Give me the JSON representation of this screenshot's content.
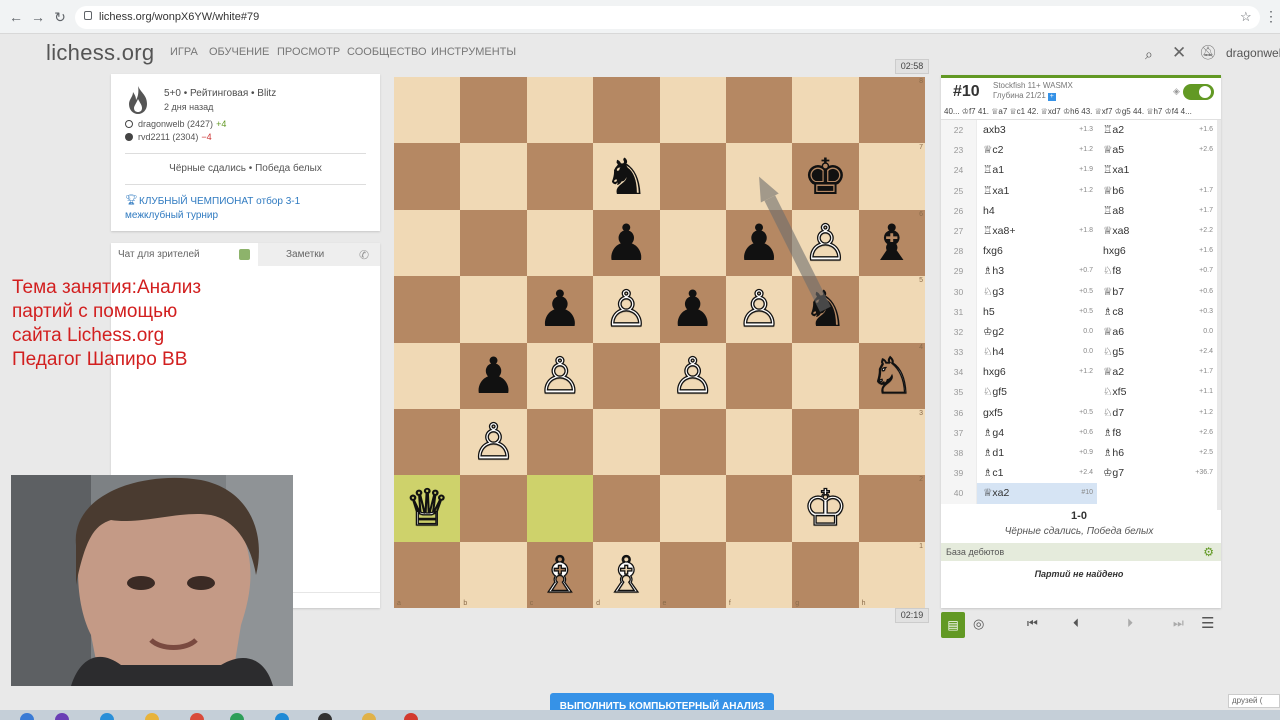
{
  "browser": {
    "url": "lichess.org/wonpX6YW/white#79",
    "back_icon": "back-arrow-icon",
    "forward_icon": "forward-arrow-icon",
    "reload_icon": "reload-icon"
  },
  "header": {
    "logo": "lichess.org",
    "nav": [
      "ИГРА",
      "ОБУЧЕНИЕ",
      "ПРОСМОТР",
      "СООБЩЕСТВО",
      "ИНСТРУМЕНТЫ"
    ],
    "username": "dragonwelb"
  },
  "game": {
    "meta": "5+0 • Рейтинговая • Blitz",
    "ago": "2 дня назад",
    "white": {
      "name": "dragonwelb (2427)",
      "diff": "+4"
    },
    "black": {
      "name": "rvd2211 (2304)",
      "diff": "−4"
    },
    "result": "Чёрные сдались • Победа белых",
    "tournament": "КЛУБНЫЙ ЧЕМПИОНАТ отбор 3-1 межклубный турнир"
  },
  "chat": {
    "tab": "Чат для зрителей",
    "notes": "Заметки"
  },
  "lesson_overlay": "Тема занятия:Анализ\nпартий с помощью\nсайта Lichess.org\nПедагог Шапиро ВВ",
  "clocks": {
    "top": "02:58",
    "bottom": "02:19"
  },
  "board": {
    "pieces": [
      {
        "sq": "d7",
        "p": "♞",
        "c": "b"
      },
      {
        "sq": "g7",
        "p": "♚",
        "c": "b"
      },
      {
        "sq": "d6",
        "p": "♟",
        "c": "b"
      },
      {
        "sq": "f6",
        "p": "♟",
        "c": "b"
      },
      {
        "sq": "g6",
        "p": "♙",
        "c": "w"
      },
      {
        "sq": "h6",
        "p": "♝",
        "c": "b"
      },
      {
        "sq": "c5",
        "p": "♟",
        "c": "b"
      },
      {
        "sq": "d5",
        "p": "♙",
        "c": "w"
      },
      {
        "sq": "e5",
        "p": "♟",
        "c": "b"
      },
      {
        "sq": "f5",
        "p": "♙",
        "c": "w"
      },
      {
        "sq": "g5",
        "p": "♞",
        "c": "b"
      },
      {
        "sq": "b4",
        "p": "♟",
        "c": "b"
      },
      {
        "sq": "c4",
        "p": "♙",
        "c": "w"
      },
      {
        "sq": "e4",
        "p": "♙",
        "c": "w"
      },
      {
        "sq": "h4",
        "p": "♘",
        "c": "w"
      },
      {
        "sq": "b3",
        "p": "♙",
        "c": "w"
      },
      {
        "sq": "a2",
        "p": "♕",
        "c": "w"
      },
      {
        "sq": "g2",
        "p": "♔",
        "c": "w"
      },
      {
        "sq": "c1",
        "p": "♗",
        "c": "w"
      },
      {
        "sq": "d1",
        "p": "♗",
        "c": "w"
      }
    ],
    "highlights": [
      "a2",
      "c2"
    ],
    "files": [
      "a",
      "b",
      "c",
      "d",
      "e",
      "f",
      "g",
      "h"
    ],
    "ranks": [
      "8",
      "7",
      "6",
      "5",
      "4",
      "3",
      "2",
      "1"
    ],
    "arrow": {
      "from": "g5",
      "to": "f7"
    }
  },
  "engine": {
    "eval": "#10",
    "name": "Stockfish 11+ WASMX",
    "depth": "Глубина 21/21",
    "pv": "40... ♔f7 41. ♕a7 ♕c1 42. ♕xd7 ♔h6 43. ♕xf7 ♔g5 44. ♕h7 ♔f4 4..."
  },
  "moves": [
    {
      "n": "22",
      "w": "axb3",
      "we": "+1.3",
      "b": "♖a2",
      "be": "+1.6"
    },
    {
      "n": "23",
      "w": "♕c2",
      "we": "+1.2",
      "b": "♕a5",
      "be": "+2.6"
    },
    {
      "n": "24",
      "w": "♖a1",
      "we": "+1.9",
      "b": "♖xa1",
      "be": ""
    },
    {
      "n": "25",
      "w": "♖xa1",
      "we": "+1.2",
      "b": "♕b6",
      "be": "+1.7"
    },
    {
      "n": "26",
      "w": "h4",
      "we": "",
      "b": "♖a8",
      "be": "+1.7"
    },
    {
      "n": "27",
      "w": "♖xa8+",
      "we": "+1.8",
      "b": "♕xa8",
      "be": "+2.2"
    },
    {
      "n": "28",
      "w": "fxg6",
      "we": "",
      "b": "hxg6",
      "be": "+1.6"
    },
    {
      "n": "29",
      "w": "♗h3",
      "we": "+0.7",
      "b": "♘f8",
      "be": "+0.7"
    },
    {
      "n": "30",
      "w": "♘g3",
      "we": "+0.5",
      "b": "♕b7",
      "be": "+0.6"
    },
    {
      "n": "31",
      "w": "h5",
      "we": "+0.5",
      "b": "♗c8",
      "be": "+0.3"
    },
    {
      "n": "32",
      "w": "♔g2",
      "we": "0.0",
      "b": "♕a6",
      "be": "0.0"
    },
    {
      "n": "33",
      "w": "♘h4",
      "we": "0.0",
      "b": "♘g5",
      "be": "+2.4"
    },
    {
      "n": "34",
      "w": "hxg6",
      "we": "+1.2",
      "b": "♕a2",
      "be": "+1.7"
    },
    {
      "n": "35",
      "w": "♘gf5",
      "we": "",
      "b": "♘xf5",
      "be": "+1.1"
    },
    {
      "n": "36",
      "w": "gxf5",
      "we": "+0.5",
      "b": "♘d7",
      "be": "+1.2"
    },
    {
      "n": "37",
      "w": "♗g4",
      "we": "+0.6",
      "b": "♗f8",
      "be": "+2.6"
    },
    {
      "n": "38",
      "w": "♗d1",
      "we": "+0.9",
      "b": "♗h6",
      "be": "+2.5"
    },
    {
      "n": "39",
      "w": "♗c1",
      "we": "+2.4",
      "b": "♔g7",
      "be": "+36.7"
    },
    {
      "n": "40",
      "w": "♕xa2",
      "we": "#10",
      "b": "",
      "be": ""
    }
  ],
  "result": {
    "score": "1-0",
    "text": "Чёрные сдались, Победа белых"
  },
  "opening": {
    "title": "База дебютов",
    "none": "Партий не найдено"
  },
  "analyse_button": "Выполнить компьютерный анализ",
  "friends": "друзей (",
  "colors": {
    "accent": "#629924",
    "link": "#2f7ac0",
    "lesson": "#d21f1f",
    "button": "#3692e7"
  }
}
